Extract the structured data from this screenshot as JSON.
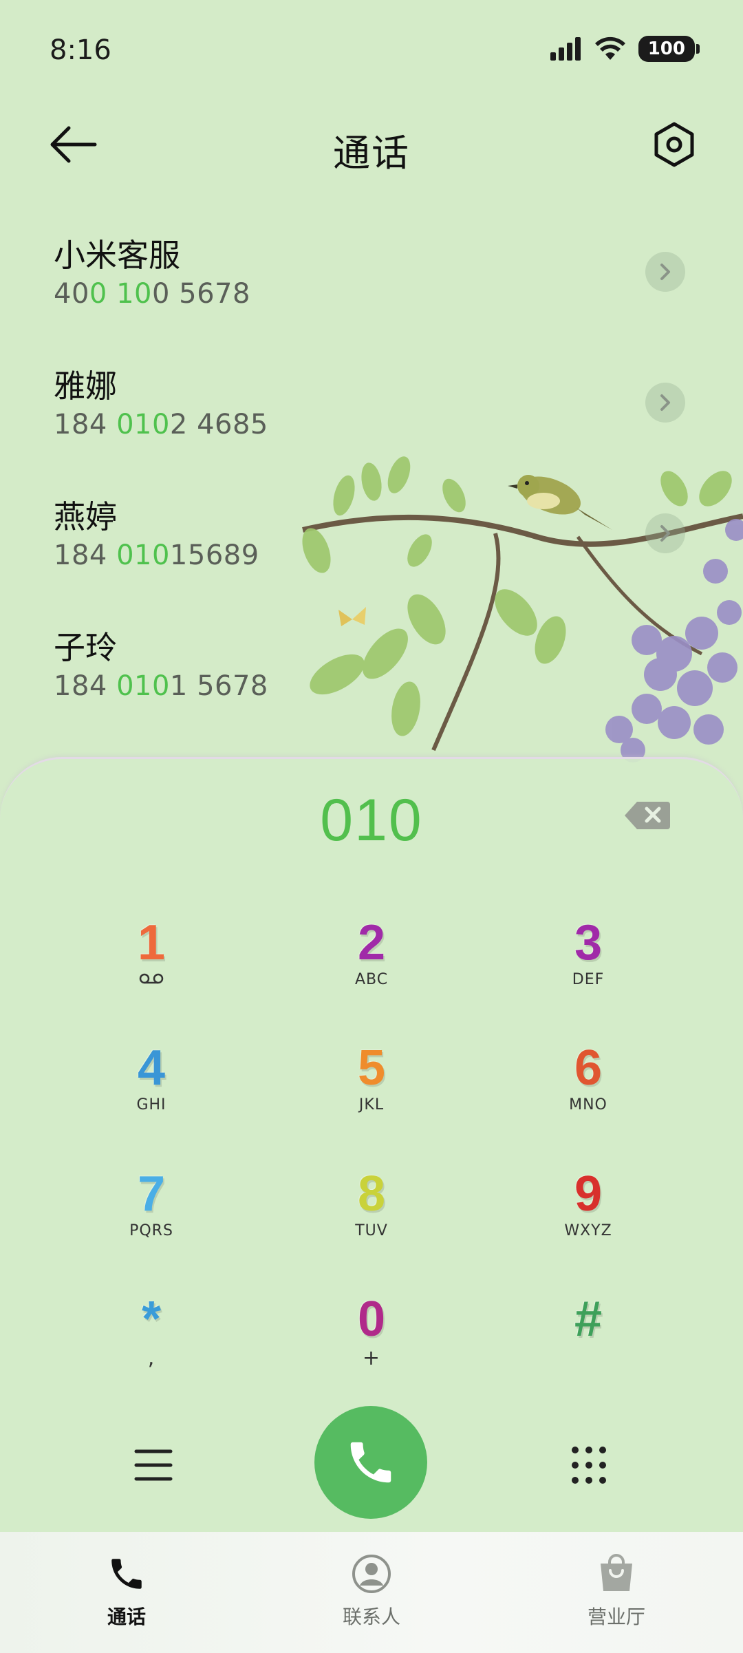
{
  "status_bar": {
    "time": "8:16",
    "battery": "100"
  },
  "header": {
    "title": "通话"
  },
  "contacts": [
    {
      "name": "小米客服",
      "number_parts": [
        {
          "text": "40",
          "hl": false
        },
        {
          "text": "0",
          "hl": true
        },
        {
          "text": " ",
          "hl": false
        },
        {
          "text": "10",
          "hl": true
        },
        {
          "text": "0 5678",
          "hl": false
        }
      ]
    },
    {
      "name": "雅娜",
      "number_parts": [
        {
          "text": "184 ",
          "hl": false
        },
        {
          "text": "010",
          "hl": true
        },
        {
          "text": "2 4685",
          "hl": false
        }
      ]
    },
    {
      "name": "燕婷",
      "number_parts": [
        {
          "text": "184 ",
          "hl": false
        },
        {
          "text": "010",
          "hl": true
        },
        {
          "text": "15689",
          "hl": false
        }
      ]
    },
    {
      "name": "子玲",
      "number_parts": [
        {
          "text": "184 ",
          "hl": false
        },
        {
          "text": "010",
          "hl": true
        },
        {
          "text": "1 5678",
          "hl": false
        }
      ]
    }
  ],
  "dialpad": {
    "input": "010",
    "keys": [
      {
        "digit": "1",
        "letters": "",
        "color": "#ee6a3c",
        "voicemail": true
      },
      {
        "digit": "2",
        "letters": "ABC",
        "color": "#a02aa8"
      },
      {
        "digit": "3",
        "letters": "DEF",
        "color": "#a02aa8"
      },
      {
        "digit": "4",
        "letters": "GHI",
        "color": "#3a96d6"
      },
      {
        "digit": "5",
        "letters": "JKL",
        "color": "#ef8c2c"
      },
      {
        "digit": "6",
        "letters": "MNO",
        "color": "#e05630"
      },
      {
        "digit": "7",
        "letters": "PQRS",
        "color": "#4aaee6"
      },
      {
        "digit": "8",
        "letters": "TUV",
        "color": "#c9d23a"
      },
      {
        "digit": "9",
        "letters": "WXYZ",
        "color": "#d8302c"
      },
      {
        "digit": "*",
        "letters": ",",
        "color": "#3a9cd8"
      },
      {
        "digit": "0",
        "letters": "+",
        "color": "#b02a8a"
      },
      {
        "digit": "#",
        "letters": "",
        "color": "#3ea05a"
      }
    ]
  },
  "nav": [
    {
      "label": "通话",
      "icon": "phone-icon",
      "active": true
    },
    {
      "label": "联系人",
      "icon": "person-icon",
      "active": false
    },
    {
      "label": "营业厅",
      "icon": "shopping-bag-icon",
      "active": false
    }
  ],
  "colors": {
    "background": "#d4ebc8",
    "accent": "#52bf4d",
    "call_button": "#56bb61"
  }
}
